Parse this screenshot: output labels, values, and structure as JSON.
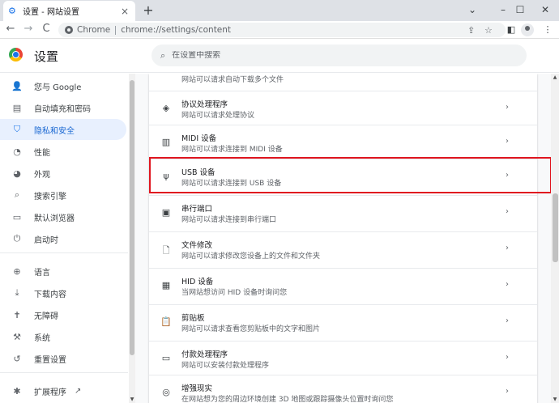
{
  "tab": {
    "title": "设置 - 网站设置",
    "close": "×",
    "new_tab": "+"
  },
  "window": {
    "chevron": "⌄",
    "minimize": "–",
    "maximize": "☐",
    "close": "✕"
  },
  "toolbar": {
    "back": "←",
    "forward": "→",
    "reload": "C",
    "chip": "Chrome",
    "url": "chrome://settings/content",
    "share": "⇪",
    "star": "☆",
    "sidepanel": "◧",
    "menu": "⋮"
  },
  "header": {
    "title": "设置",
    "search_icon": "⌕",
    "search_placeholder": "在设置中搜索"
  },
  "sidebar": {
    "items": [
      {
        "label": "您与 Google",
        "icon": "👤"
      },
      {
        "label": "自动填充和密码",
        "icon": "▤"
      },
      {
        "label": "隐私和安全",
        "icon": "⛉"
      },
      {
        "label": "性能",
        "icon": "◔"
      },
      {
        "label": "外观",
        "icon": "◕"
      },
      {
        "label": "搜索引擎",
        "icon": "⌕"
      },
      {
        "label": "默认浏览器",
        "icon": "▭"
      },
      {
        "label": "启动时",
        "icon": "⏻"
      },
      {
        "label": "语言",
        "icon": "⊕"
      },
      {
        "label": "下载内容",
        "icon": "⤓"
      },
      {
        "label": "无障碍",
        "icon": "✝"
      },
      {
        "label": "系统",
        "icon": "⚒"
      },
      {
        "label": "重置设置",
        "icon": "↺"
      },
      {
        "label": "扩展程序",
        "icon": "✱",
        "ext_icon": "↗"
      }
    ],
    "active": "隐私和安全"
  },
  "content": {
    "partial_top": {
      "desc": "网站可以请求自动下载多个文件"
    },
    "rows": [
      {
        "title": "协议处理程序",
        "desc": "网站可以请求处理协议",
        "icon": "◈"
      },
      {
        "title": "MIDI 设备",
        "desc": "网站可以请求连接到 MIDI 设备",
        "icon": "▥"
      },
      {
        "title": "USB 设备",
        "desc": "网站可以请求连接到 USB 设备",
        "icon": "ψ"
      },
      {
        "title": "串行端口",
        "desc": "网站可以请求连接到串行端口",
        "icon": "▣"
      },
      {
        "title": "文件修改",
        "desc": "网站可以请求修改您设备上的文件和文件夹",
        "icon": "🗋"
      },
      {
        "title": "HID 设备",
        "desc": "当网站想访问 HID 设备时询问您",
        "icon": "▦"
      },
      {
        "title": "剪贴板",
        "desc": "网站可以请求查看您剪贴板中的文字和图片",
        "icon": "📋"
      },
      {
        "title": "付款处理程序",
        "desc": "网站可以安装付款处理程序",
        "icon": "▭"
      },
      {
        "title": "增强现实",
        "desc": "在网站想为您的周边环境创建 3D 地图或跟踪摄像头位置时询问您",
        "icon": "◎"
      }
    ],
    "chevron": "›"
  }
}
